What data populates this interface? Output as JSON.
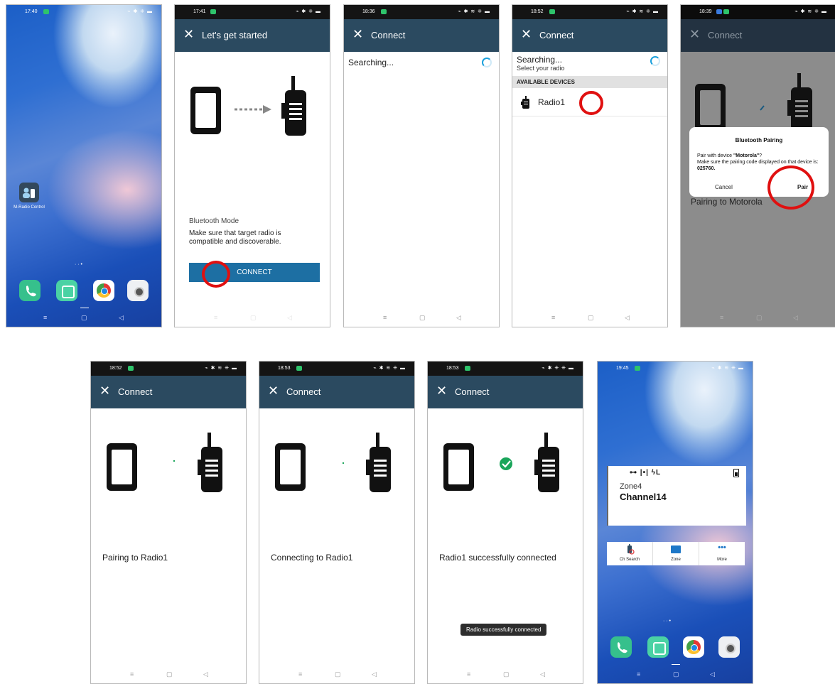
{
  "screens": [
    {
      "time": "17:40",
      "app_label": "M-Radio Control"
    },
    {
      "time": "17:41",
      "title": "Let's get started",
      "mode_title": "Bluetooth Mode",
      "mode_desc": "Make sure that target radio is compatible and discoverable.",
      "button": "CONNECT"
    },
    {
      "time": "18:36",
      "title": "Connect",
      "searching": "Searching..."
    },
    {
      "time": "18:52",
      "title": "Connect",
      "searching": "Searching...",
      "sub": "Select your radio",
      "section": "AVAILABLE DEVICES",
      "device": "Radio1"
    },
    {
      "time": "18:39",
      "title": "Connect",
      "dialog_title": "Bluetooth Pairing",
      "dialog_line1a": "Pair with device ",
      "dialog_device": "\"Motorola\"",
      "dialog_line1b": "?",
      "dialog_line2": "Make sure the pairing code displayed on that device is:",
      "dialog_code": "025760.",
      "cancel": "Cancel",
      "pair": "Pair",
      "behind": "Pairing to Motorola"
    },
    {
      "time": "18:52",
      "title": "Connect",
      "message": "Pairing to Radio1"
    },
    {
      "time": "18:53",
      "title": "Connect",
      "message": "Connecting to Radio1"
    },
    {
      "time": "18:53",
      "title": "Connect",
      "message": "Radio1 successfully connected",
      "toast": "Radio successfully connected"
    },
    {
      "time": "19:45",
      "status_glyphs": "⊶ |•| ϟL",
      "zone": "Zone4",
      "channel": "Channel14",
      "actions": [
        "Ch Search",
        "Zone",
        "More"
      ]
    }
  ],
  "colors": {
    "appbar": "#2b4a60",
    "button": "#1d6fa3",
    "highlight": "#e01010",
    "success": "#1aa55a"
  }
}
